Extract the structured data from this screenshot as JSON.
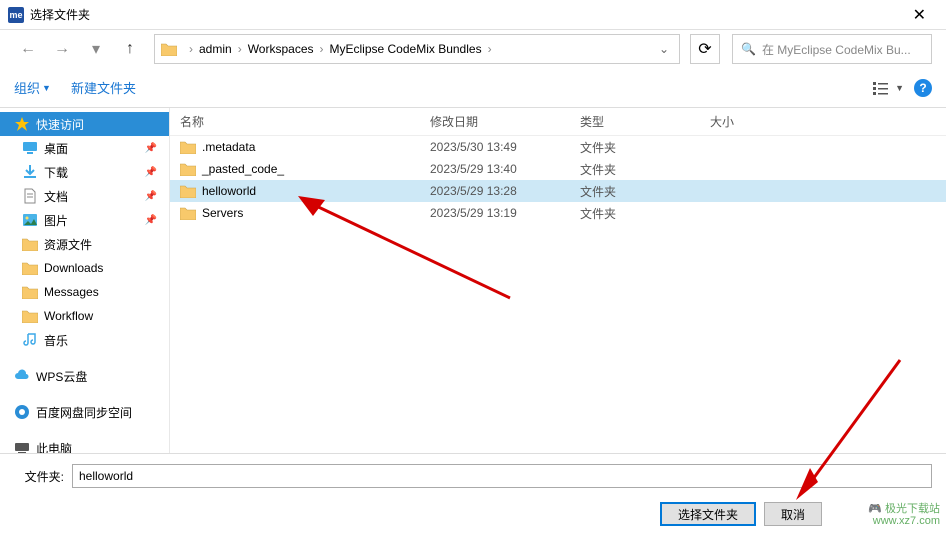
{
  "window": {
    "title": "选择文件夹"
  },
  "breadcrumb": {
    "items": [
      "admin",
      "Workspaces",
      "MyEclipse CodeMix Bundles"
    ]
  },
  "search": {
    "placeholder": "在 MyEclipse CodeMix Bu..."
  },
  "toolbar": {
    "organize": "组织",
    "newfolder": "新建文件夹"
  },
  "columns": {
    "name": "名称",
    "date": "修改日期",
    "type": "类型",
    "size": "大小"
  },
  "sidebar": {
    "items": [
      {
        "label": "快速访问",
        "icon": "star",
        "active": true,
        "top": true
      },
      {
        "label": "桌面",
        "icon": "desktop",
        "pin": true
      },
      {
        "label": "下载",
        "icon": "download",
        "pin": true
      },
      {
        "label": "文档",
        "icon": "document",
        "pin": true
      },
      {
        "label": "图片",
        "icon": "picture",
        "pin": true
      },
      {
        "label": "资源文件",
        "icon": "folder"
      },
      {
        "label": "Downloads",
        "icon": "folder"
      },
      {
        "label": "Messages",
        "icon": "folder"
      },
      {
        "label": "Workflow",
        "icon": "folder"
      },
      {
        "label": "音乐",
        "icon": "music"
      },
      {
        "label": "WPS云盘",
        "icon": "cloud",
        "top": true,
        "spacer": true
      },
      {
        "label": "百度网盘同步空间",
        "icon": "baidu",
        "top": true,
        "spacer": true
      },
      {
        "label": "此电脑",
        "icon": "pc",
        "top": true,
        "spacer": true
      }
    ]
  },
  "rows": [
    {
      "name": ".metadata",
      "date": "2023/5/30 13:49",
      "type": "文件夹",
      "selected": false
    },
    {
      "name": "_pasted_code_",
      "date": "2023/5/29 13:40",
      "type": "文件夹",
      "selected": false
    },
    {
      "name": "helloworld",
      "date": "2023/5/29 13:28",
      "type": "文件夹",
      "selected": true
    },
    {
      "name": "Servers",
      "date": "2023/5/29 13:19",
      "type": "文件夹",
      "selected": false
    }
  ],
  "footer": {
    "label": "文件夹:",
    "value": "helloworld",
    "ok": "选择文件夹",
    "cancel": "取消"
  },
  "watermark": {
    "line1": "极光下载站",
    "line2": "www.xz7.com"
  }
}
